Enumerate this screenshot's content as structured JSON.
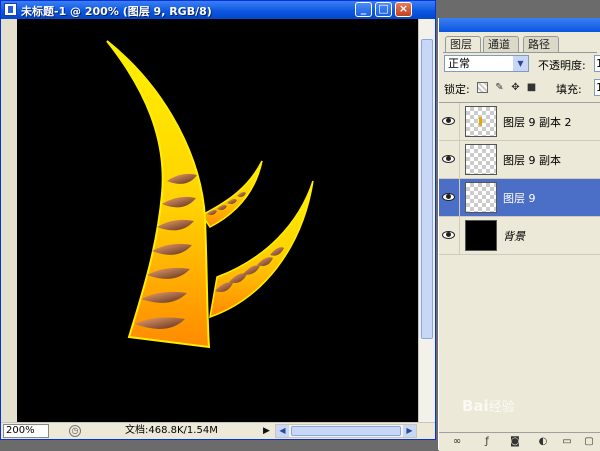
{
  "document_window": {
    "title": "未标题-1 @ 200% (图层 9, RGB/8)",
    "buttons": {
      "minimize": "_",
      "maximize": "□",
      "close": "×"
    }
  },
  "status_bar": {
    "zoom": "200%",
    "doc_info": "文档:468.8K/1.54M",
    "arrow": "▶"
  },
  "layers_panel": {
    "tabs": [
      {
        "label": "图层",
        "active": true
      },
      {
        "label": "通道",
        "active": false
      },
      {
        "label": "路径",
        "active": false
      }
    ],
    "blend_mode": "正常",
    "opacity_label": "不透明度:",
    "opacity_value": "1",
    "lock_label": "锁定:",
    "fill_label": "填充:",
    "fill_value": "1",
    "layers": [
      {
        "name": "图层 9 副本 2",
        "visible": true,
        "selected": false,
        "thumb": "transparent-mark"
      },
      {
        "name": "图层 9 副本",
        "visible": true,
        "selected": false,
        "thumb": "transparent"
      },
      {
        "name": "图层 9",
        "visible": true,
        "selected": true,
        "thumb": "transparent"
      },
      {
        "name": "背景",
        "visible": true,
        "selected": false,
        "thumb": "black"
      }
    ]
  },
  "watermark": {
    "text": "Bai",
    "suffix": "经验"
  },
  "colors": {
    "titlebar": "#0a55e0",
    "selected_layer": "#4b6ec6",
    "canvas": "#000000",
    "horn_yellow": "#ffe600",
    "horn_orange": "#ff8c00"
  }
}
